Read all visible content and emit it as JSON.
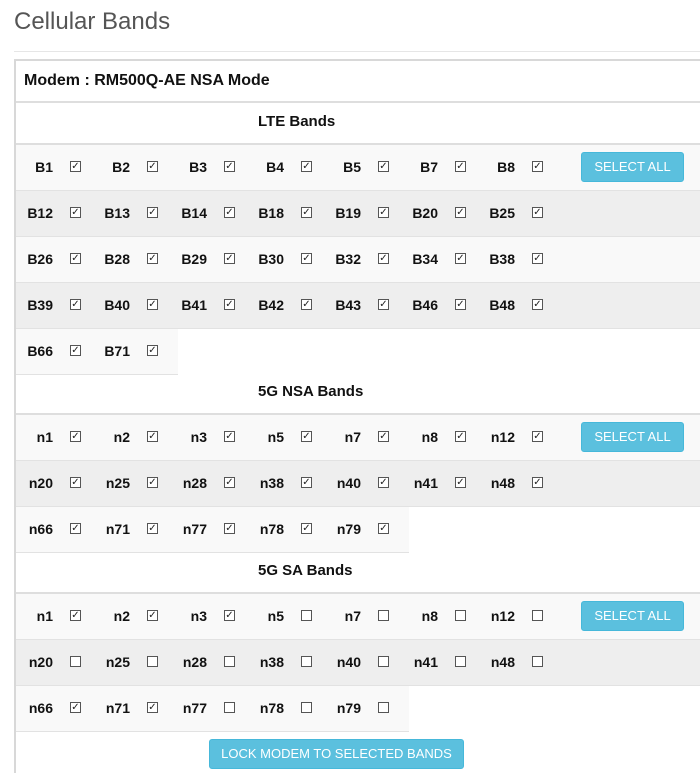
{
  "page": {
    "title": "Cellular Bands"
  },
  "modem": {
    "label": "Modem : RM500Q-AE NSA Mode"
  },
  "sections": [
    {
      "title": "LTE Bands",
      "select_all_label": "SELECT ALL",
      "rows": [
        [
          {
            "band": "B1",
            "checked": true
          },
          {
            "band": "B2",
            "checked": true
          },
          {
            "band": "B3",
            "checked": true
          },
          {
            "band": "B4",
            "checked": true
          },
          {
            "band": "B5",
            "checked": true
          },
          {
            "band": "B7",
            "checked": true
          },
          {
            "band": "B8",
            "checked": true
          }
        ],
        [
          {
            "band": "B12",
            "checked": true
          },
          {
            "band": "B13",
            "checked": true
          },
          {
            "band": "B14",
            "checked": true
          },
          {
            "band": "B18",
            "checked": true
          },
          {
            "band": "B19",
            "checked": true
          },
          {
            "band": "B20",
            "checked": true
          },
          {
            "band": "B25",
            "checked": true
          }
        ],
        [
          {
            "band": "B26",
            "checked": true
          },
          {
            "band": "B28",
            "checked": true
          },
          {
            "band": "B29",
            "checked": true
          },
          {
            "band": "B30",
            "checked": true
          },
          {
            "band": "B32",
            "checked": true
          },
          {
            "band": "B34",
            "checked": true
          },
          {
            "band": "B38",
            "checked": true
          }
        ],
        [
          {
            "band": "B39",
            "checked": true
          },
          {
            "band": "B40",
            "checked": true
          },
          {
            "band": "B41",
            "checked": true
          },
          {
            "band": "B42",
            "checked": true
          },
          {
            "band": "B43",
            "checked": true
          },
          {
            "band": "B46",
            "checked": true
          },
          {
            "band": "B48",
            "checked": true
          }
        ],
        [
          {
            "band": "B66",
            "checked": true
          },
          {
            "band": "B71",
            "checked": true
          }
        ]
      ]
    },
    {
      "title": "5G NSA Bands",
      "select_all_label": "SELECT ALL",
      "rows": [
        [
          {
            "band": "n1",
            "checked": true
          },
          {
            "band": "n2",
            "checked": true
          },
          {
            "band": "n3",
            "checked": true
          },
          {
            "band": "n5",
            "checked": true
          },
          {
            "band": "n7",
            "checked": true
          },
          {
            "band": "n8",
            "checked": true
          },
          {
            "band": "n12",
            "checked": true
          }
        ],
        [
          {
            "band": "n20",
            "checked": true
          },
          {
            "band": "n25",
            "checked": true
          },
          {
            "band": "n28",
            "checked": true
          },
          {
            "band": "n38",
            "checked": true
          },
          {
            "band": "n40",
            "checked": true
          },
          {
            "band": "n41",
            "checked": true
          },
          {
            "band": "n48",
            "checked": true
          }
        ],
        [
          {
            "band": "n66",
            "checked": true
          },
          {
            "band": "n71",
            "checked": true
          },
          {
            "band": "n77",
            "checked": true
          },
          {
            "band": "n78",
            "checked": true
          },
          {
            "band": "n79",
            "checked": true
          }
        ]
      ]
    },
    {
      "title": "5G SA Bands",
      "select_all_label": "SELECT ALL",
      "rows": [
        [
          {
            "band": "n1",
            "checked": true
          },
          {
            "band": "n2",
            "checked": true
          },
          {
            "band": "n3",
            "checked": true
          },
          {
            "band": "n5",
            "checked": false
          },
          {
            "band": "n7",
            "checked": false
          },
          {
            "band": "n8",
            "checked": false
          },
          {
            "band": "n12",
            "checked": false
          }
        ],
        [
          {
            "band": "n20",
            "checked": false
          },
          {
            "band": "n25",
            "checked": false
          },
          {
            "band": "n28",
            "checked": false
          },
          {
            "band": "n38",
            "checked": false
          },
          {
            "band": "n40",
            "checked": false
          },
          {
            "band": "n41",
            "checked": false
          },
          {
            "band": "n48",
            "checked": false
          }
        ],
        [
          {
            "band": "n66",
            "checked": true
          },
          {
            "band": "n71",
            "checked": true
          },
          {
            "band": "n77",
            "checked": false
          },
          {
            "band": "n78",
            "checked": false
          },
          {
            "band": "n79",
            "checked": false
          }
        ]
      ]
    }
  ],
  "lock_button_label": "LOCK MODEM TO SELECTED BANDS",
  "colors": {
    "button": "#5bc0de",
    "row_alt": "#eeeeee"
  }
}
